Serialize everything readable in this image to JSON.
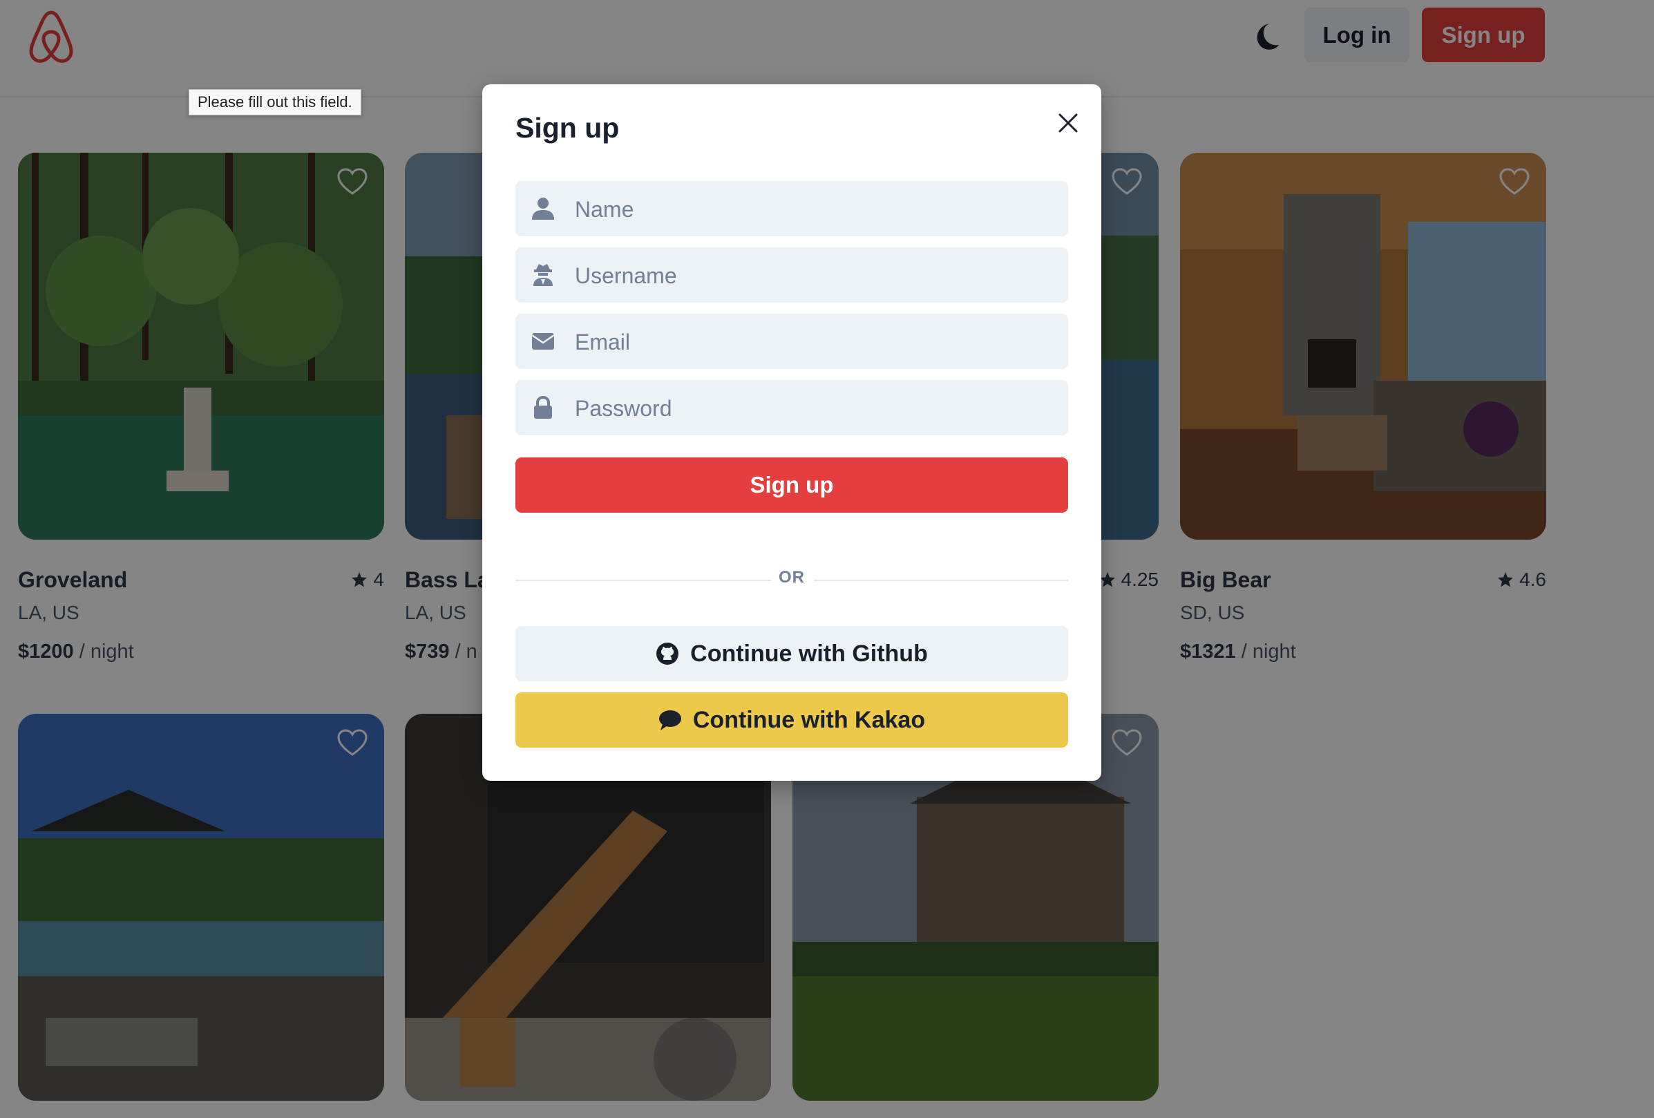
{
  "header": {
    "logo_icon": "airbnb-logo",
    "theme_icon": "moon-icon",
    "login_label": "Log in",
    "signup_label": "Sign up",
    "accent_color": "#e53e3e"
  },
  "validation_tooltip": "Please fill out this field.",
  "listings": [
    {
      "title": "Groveland",
      "rating": "4",
      "location": "LA, US",
      "price": "$1200",
      "unit": " / night",
      "scene": "lake-forest"
    },
    {
      "title": "Bass La",
      "rating": "",
      "location": "LA, US",
      "price": "$739",
      "unit": " / n",
      "scene": "lake-dock"
    },
    {
      "title": "",
      "rating": "4.25",
      "location": "",
      "price": "",
      "unit": "",
      "scene": "lakeshore"
    },
    {
      "title": "Big Bear",
      "rating": "4.6",
      "location": "SD, US",
      "price": "$1321",
      "unit": " / night",
      "scene": "cabin-interior"
    },
    {
      "title": "",
      "rating": "",
      "location": "",
      "price": "",
      "unit": "",
      "scene": "deck-lake"
    },
    {
      "title": "",
      "rating": "",
      "location": "",
      "price": "",
      "unit": "",
      "scene": "cabin-stairs"
    },
    {
      "title": "",
      "rating": "",
      "location": "",
      "price": "",
      "unit": "",
      "scene": "house-lawn"
    }
  ],
  "modal": {
    "title": "Sign up",
    "close_icon": "close-icon",
    "fields": {
      "name": {
        "placeholder": "Name",
        "icon": "user-icon"
      },
      "username": {
        "placeholder": "Username",
        "icon": "user-secret-icon"
      },
      "email": {
        "placeholder": "Email",
        "icon": "envelope-icon"
      },
      "password": {
        "placeholder": "Password",
        "icon": "lock-icon"
      }
    },
    "submit_label": "Sign up",
    "divider_label": "OR",
    "github_label": "Continue with Github",
    "kakao_label": "Continue with Kakao",
    "kakao_color": "#ecc94b"
  }
}
